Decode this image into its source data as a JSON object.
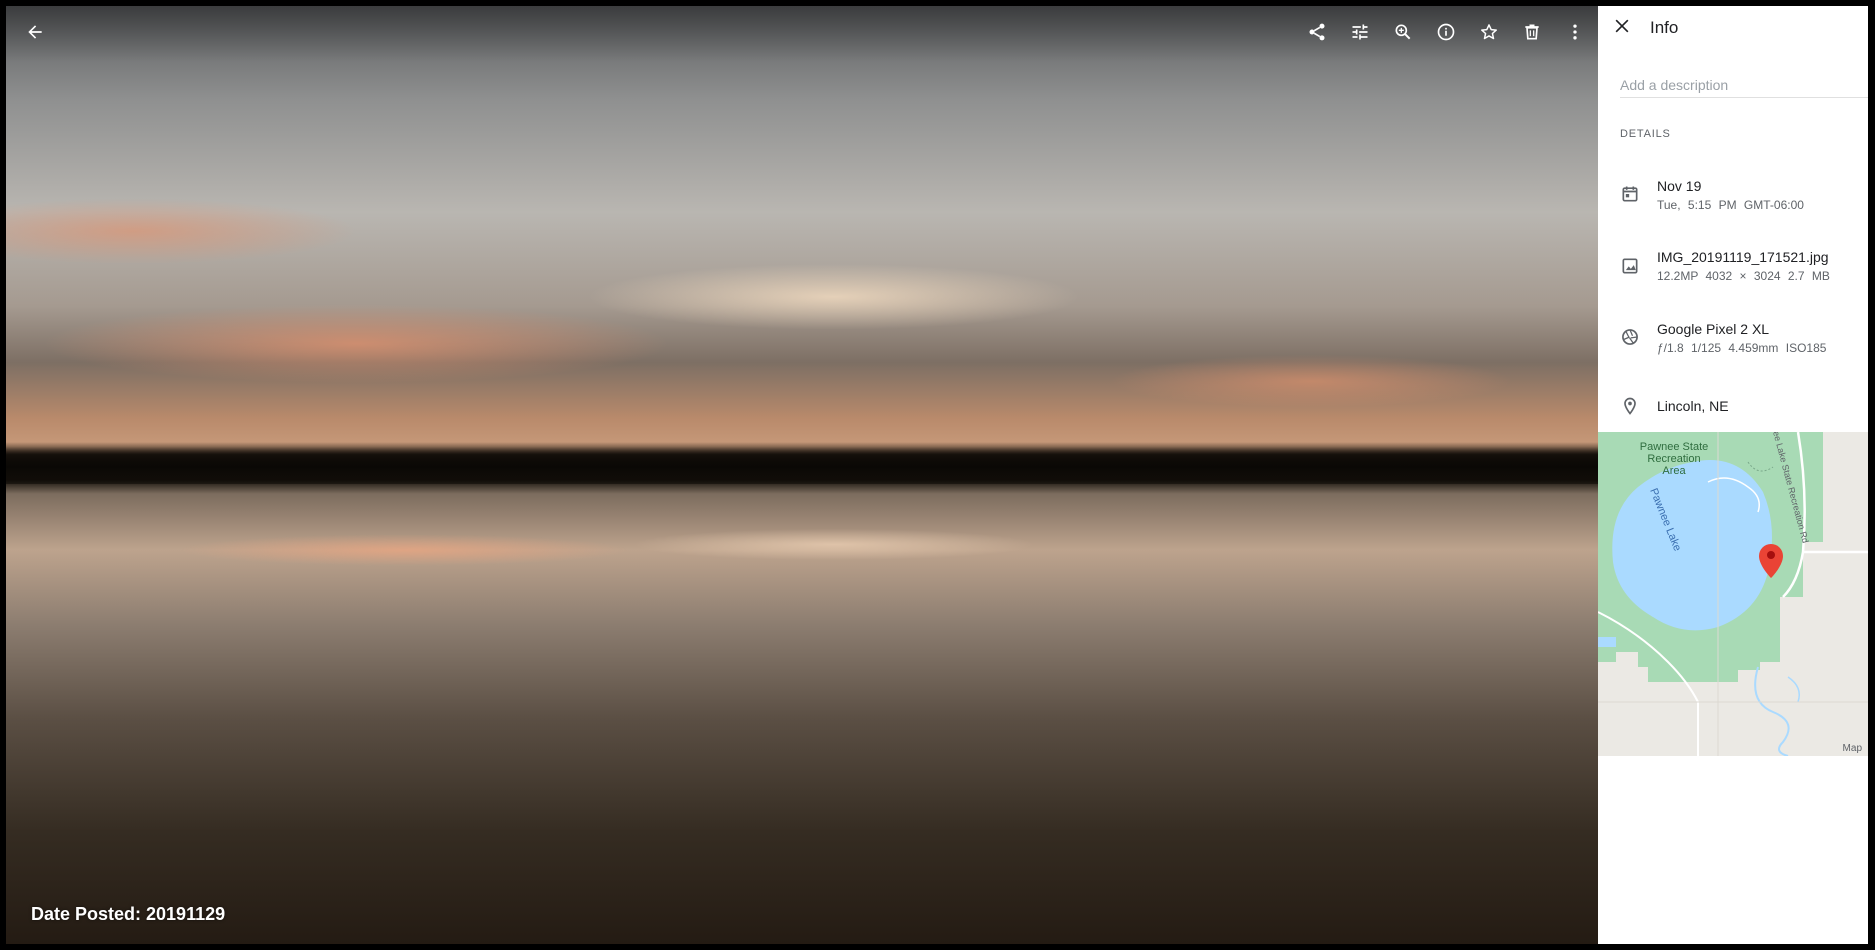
{
  "viewer": {
    "date_posted": "Date Posted: 20191129",
    "toolbar": {
      "back": "arrow-back-icon",
      "actions": [
        "share-icon",
        "tune-icon",
        "zoom-in-icon",
        "info-icon",
        "star-icon",
        "trash-icon",
        "more-vert-icon"
      ]
    }
  },
  "info_panel": {
    "title": "Info",
    "description_placeholder": "Add a description",
    "details_heading": "DETAILS",
    "date": {
      "line1": "Nov 19",
      "line2": "Tue, 5:15 PM   GMT-06:00"
    },
    "file": {
      "line1": "IMG_20191119_171521.jpg",
      "line2": "12.2MP   4032 × 3024   2.7 MB"
    },
    "camera": {
      "line1": "Google Pixel 2 XL",
      "line2": "ƒ/1.8   1/125   4.459mm   ISO185"
    },
    "location": {
      "line1": "Lincoln, NE"
    },
    "map": {
      "area_label": "Pawnee State Recreation Area",
      "lake_label": "Pawnee Lake",
      "road_label": "ee Lake State Recreation Rd",
      "credit": "Map"
    }
  },
  "colors": {
    "water": "#aadaff",
    "park": "#a8dab5",
    "pin": "#ea4335"
  }
}
